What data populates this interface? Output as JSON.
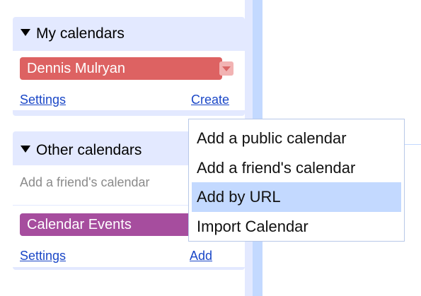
{
  "my_calendars": {
    "header": "My calendars",
    "calendar": {
      "name": "Dennis Mulryan",
      "color": "#dd6262"
    },
    "settings_label": "Settings",
    "create_label": "Create"
  },
  "other_calendars": {
    "header": "Other calendars",
    "add_friend_placeholder": "Add a friend's calendar",
    "calendar": {
      "name": "Calendar Events",
      "color": "#a64d9e"
    },
    "settings_label": "Settings",
    "add_label": "Add"
  },
  "add_menu": {
    "items": [
      {
        "label": "Add a public calendar",
        "highlighted": false
      },
      {
        "label": "Add a friend's calendar",
        "highlighted": false
      },
      {
        "label": "Add by URL",
        "highlighted": true
      },
      {
        "label": "Import Calendar",
        "highlighted": false
      }
    ]
  },
  "colors": {
    "panel_bg": "#e3e9ff",
    "link": "#1a47c7",
    "menu_highlight": "#c3d9ff"
  }
}
